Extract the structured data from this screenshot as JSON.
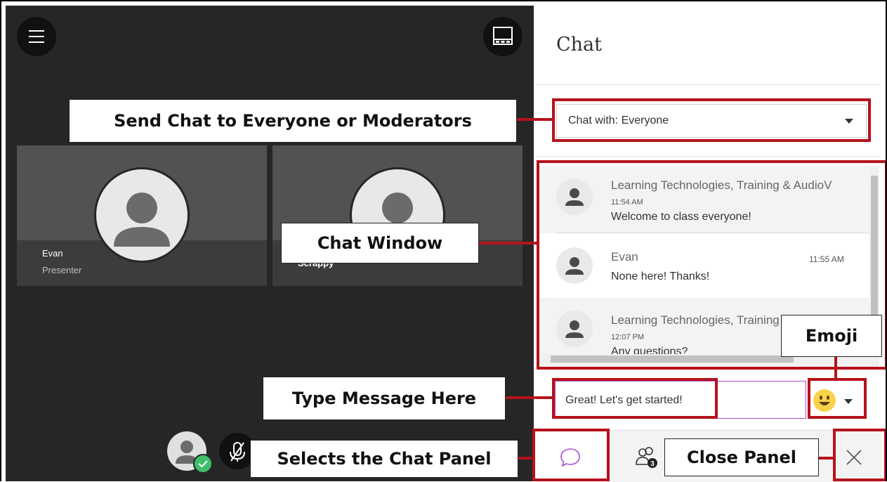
{
  "stage": {
    "participants": [
      {
        "name": "Evan",
        "role": "Presenter"
      },
      {
        "name": "Scrappy"
      }
    ]
  },
  "panel": {
    "title": "Chat",
    "chat_with": "Chat with: Everyone",
    "messages": [
      {
        "sender": "Learning Technologies, Training & AudioV",
        "time": "11:54 AM",
        "text": "Welcome to class everyone!"
      },
      {
        "sender": "Evan",
        "time": "11:55 AM",
        "text": "None here! Thanks!"
      },
      {
        "sender": "Learning Technologies, Training & AudioV",
        "time": "12:07 PM",
        "text": "Any questions?"
      }
    ],
    "compose_value": "Great! Let's get started!",
    "attendee_count": "3"
  },
  "annotations": {
    "send_chat": "Send Chat to Everyone or Moderators",
    "chat_window": "Chat Window",
    "emoji": "Emoji",
    "type_message": "Type Message Here",
    "selects_chat": "Selects the Chat Panel",
    "close_panel": "Close Panel"
  },
  "colors": {
    "annotation_red": "#b5121b",
    "compose_border": "#a74fd4",
    "presence_green": "#3fbf6a",
    "emoji_yellow": "#f8d24a"
  }
}
